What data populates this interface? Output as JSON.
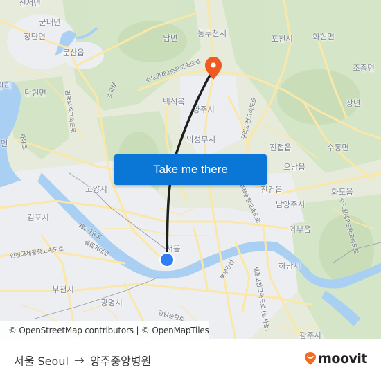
{
  "map": {
    "place_labels": [
      {
        "id": "sinseo",
        "text": "신서면"
      },
      {
        "id": "gunnae",
        "text": "군내면"
      },
      {
        "id": "jangdan",
        "text": "장단면"
      },
      {
        "id": "munsan",
        "text": "문산읍"
      },
      {
        "id": "nam",
        "text": "남면"
      },
      {
        "id": "dongducheon",
        "text": "동두천시"
      },
      {
        "id": "pocheon",
        "text": "포천시"
      },
      {
        "id": "hwahyeon",
        "text": "화현면"
      },
      {
        "id": "jojong",
        "text": "조종면"
      },
      {
        "id": "tanhyeon",
        "text": "탄현면"
      },
      {
        "id": "baekseok",
        "text": "백석읍"
      },
      {
        "id": "yangju",
        "text": "양주시"
      },
      {
        "id": "sang",
        "text": "상면"
      },
      {
        "id": "uijeongbu",
        "text": "의정부시"
      },
      {
        "id": "jinjeop",
        "text": "진접읍"
      },
      {
        "id": "sudong",
        "text": "수동면"
      },
      {
        "id": "onam",
        "text": "오남읍"
      },
      {
        "id": "goyang",
        "text": "고양시"
      },
      {
        "id": "jingeon",
        "text": "진건읍"
      },
      {
        "id": "hwado",
        "text": "화도읍"
      },
      {
        "id": "namyangju",
        "text": "남양주시"
      },
      {
        "id": "gimpo",
        "text": "김포시"
      },
      {
        "id": "wabu",
        "text": "와부읍"
      },
      {
        "id": "seoul",
        "text": "서울"
      },
      {
        "id": "hanam",
        "text": "하남시"
      },
      {
        "id": "bucheon",
        "text": "부천시"
      },
      {
        "id": "gwangmyeong",
        "text": "광명시"
      },
      {
        "id": "gwangju",
        "text": "광주시"
      },
      {
        "id": "lri",
        "text": "관리"
      },
      {
        "id": "myeon_w",
        "text": "면"
      }
    ],
    "road_labels": [
      {
        "id": "capital2",
        "text": "수도권제2순환고속도로"
      },
      {
        "id": "pyeongtaek",
        "text": "평택파주고속도로"
      },
      {
        "id": "jayu",
        "text": "자유로"
      },
      {
        "id": "je2jayu",
        "text": "제2자유로"
      },
      {
        "id": "olympic",
        "text": "올림픽대로"
      },
      {
        "id": "incheon_airport",
        "text": "인천국제공항고속도로"
      },
      {
        "id": "gangnam",
        "text": "강남순환로"
      },
      {
        "id": "sejong",
        "text": "세종포천고속도로 (공사중)"
      },
      {
        "id": "guri_pocheon",
        "text": "구리포천고속도로"
      },
      {
        "id": "seoul_ring",
        "text": "서울외곽순환고속도로"
      },
      {
        "id": "bukbu",
        "text": "북부간선"
      },
      {
        "id": "capital2_e",
        "text": "수도권제2순환고속도로"
      },
      {
        "id": "hoguk",
        "text": "호국로"
      }
    ],
    "origin_marker": {
      "label": "origin",
      "color": "#2f7ef5"
    },
    "destination_marker": {
      "label": "destination",
      "color": "#f05a22"
    },
    "route_color": "#1e1e1e",
    "cta_label": "Take me there",
    "attribution": "© OpenStreetMap contributors | © OpenMapTiles"
  },
  "footer": {
    "origin": "서울 Seoul",
    "arrow": "→",
    "destination": "양주중앙병원",
    "brand": "moovit",
    "brand_color": "#f26b21"
  }
}
